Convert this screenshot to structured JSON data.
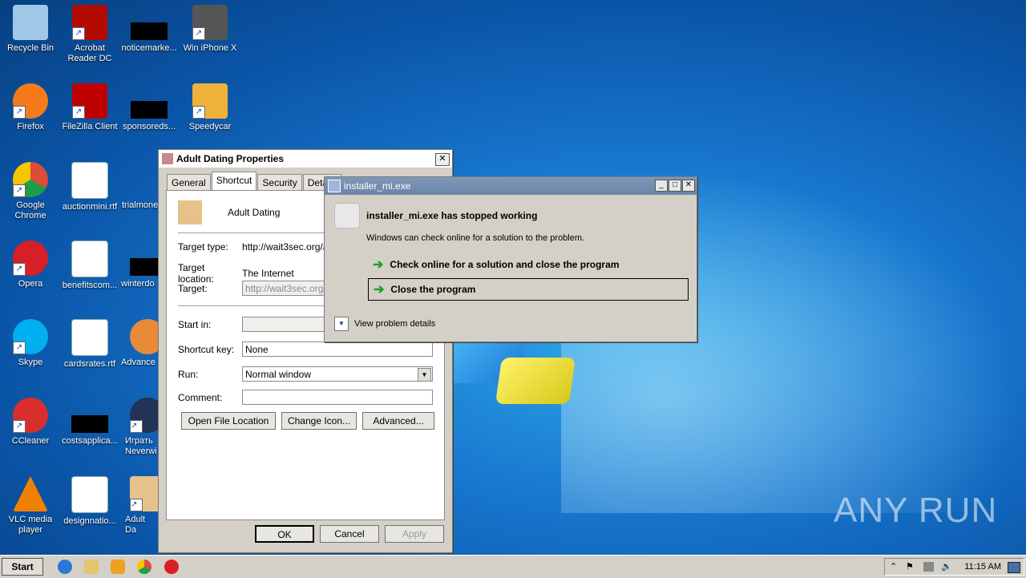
{
  "desktop": {
    "icons": [
      {
        "label": "Recycle Bin",
        "color": "#9fc7e8"
      },
      {
        "label": "Acrobat\nReader DC",
        "color": "#b30b00"
      },
      {
        "label": "noticemarke...",
        "color": "#000000"
      },
      {
        "label": "Win iPhone X",
        "color": "#555555"
      },
      {
        "label": "Firefox",
        "color": "#f57a1b"
      },
      {
        "label": "FileZilla Client",
        "color": "#bf0000"
      },
      {
        "label": "sponsoreds...",
        "color": "#000000"
      },
      {
        "label": "Speedycar",
        "color": "#f0b13a"
      },
      {
        "label": "Google\nChrome",
        "color": "#dd4b39"
      },
      {
        "label": "auctionmini.rtf",
        "color": "#ffffff"
      },
      {
        "label": "trialmone",
        "color": "#1f68c1"
      },
      {
        "label": "Opera",
        "color": "#d61f26"
      },
      {
        "label": "benefitscom...",
        "color": "#ffffff"
      },
      {
        "label": "winterdo",
        "color": "#000000"
      },
      {
        "label": "Skype",
        "color": "#00aff0"
      },
      {
        "label": "cardsrates.rtf",
        "color": "#ffffff"
      },
      {
        "label": "Advance",
        "color": "#e88a3a"
      },
      {
        "label": "CCleaner",
        "color": "#d92e2e"
      },
      {
        "label": "costsapplica...",
        "color": "#000000"
      },
      {
        "label": "Играть\nNeverwi",
        "color": "#223355"
      },
      {
        "label": "VLC media\nplayer",
        "color": "#f08000"
      },
      {
        "label": "designnatio...",
        "color": "#ffffff"
      },
      {
        "label": "Adult Da",
        "color": "#e6c28a"
      }
    ]
  },
  "props": {
    "title": "Adult Dating Properties",
    "tabs": [
      "General",
      "Shortcut",
      "Security",
      "Details"
    ],
    "active_tab": "Shortcut",
    "name": "Adult Dating",
    "target_type_label": "Target type:",
    "target_type": "http://wait3sec.org/a",
    "target_location_label": "Target location:",
    "target_location": "The Internet",
    "target_label": "Target:",
    "target": "http://wait3sec.org/a",
    "start_in_label": "Start in:",
    "start_in": "",
    "shortcut_key_label": "Shortcut key:",
    "shortcut_key": "None",
    "run_label": "Run:",
    "run": "Normal window",
    "comment_label": "Comment:",
    "comment": "",
    "btn_open_location": "Open File Location",
    "btn_change_icon": "Change Icon...",
    "btn_advanced": "Advanced...",
    "btn_ok": "OK",
    "btn_cancel": "Cancel",
    "btn_apply": "Apply"
  },
  "err": {
    "title": "installer_mi.exe",
    "heading": "installer_mi.exe has stopped working",
    "message": "Windows can check online for a solution to the problem.",
    "opt_online": "Check online for a solution and close the program",
    "opt_close": "Close the program",
    "details": "View problem details"
  },
  "taskbar": {
    "start": "Start",
    "clock": "11:15 AM"
  },
  "watermark": "ANY RUN"
}
